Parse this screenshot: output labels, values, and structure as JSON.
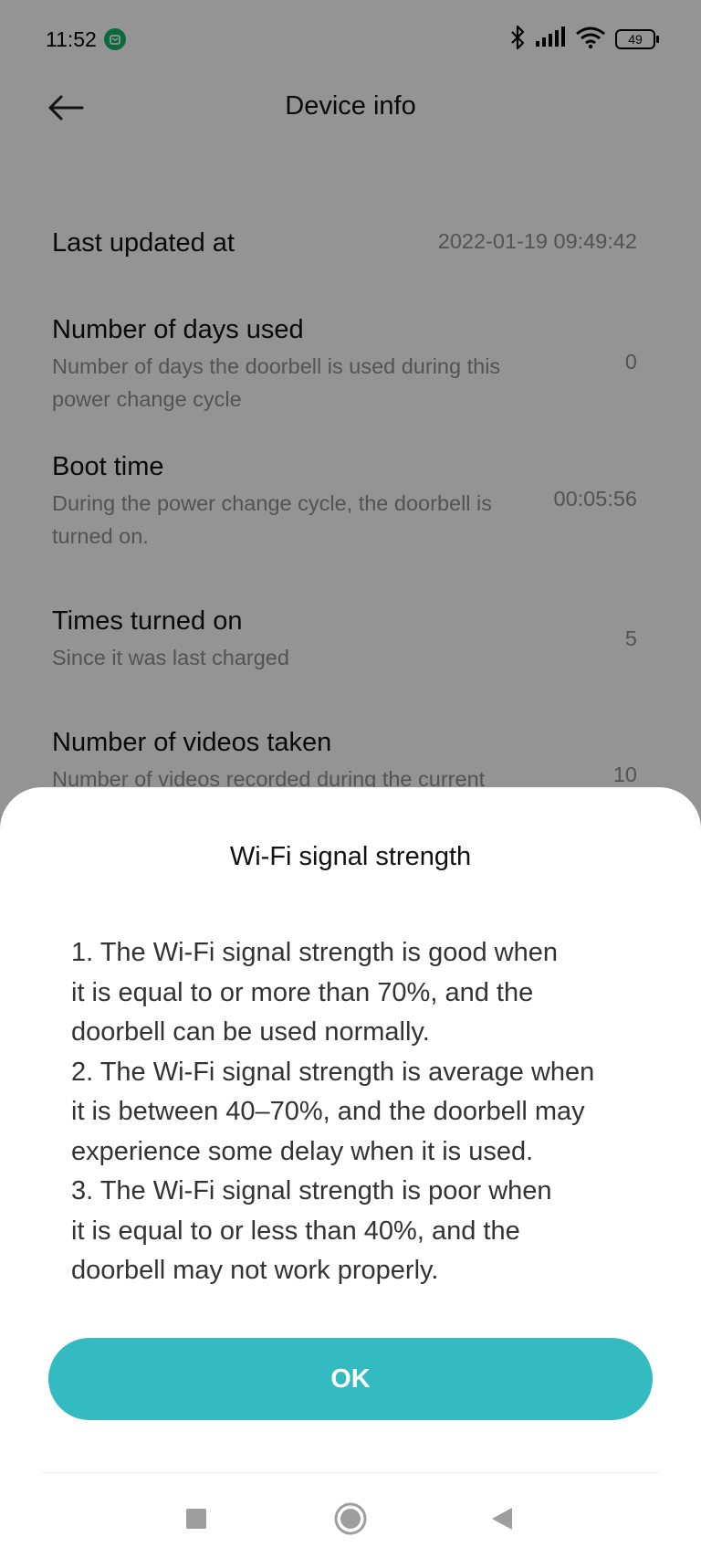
{
  "status_bar": {
    "time": "11:52",
    "battery_level": "49",
    "icons": [
      "mi-home-badge-icon",
      "bluetooth-icon",
      "cellular-signal-icon",
      "wifi-icon",
      "battery-icon"
    ]
  },
  "header": {
    "title": "Device info",
    "back_icon": "back-arrow-icon"
  },
  "info_rows": [
    {
      "title": "Last updated at",
      "value": "2022-01-19 09:49:42"
    },
    {
      "title": "Number of days used",
      "desc": [
        "Number of days the doorbell is used during this",
        "power change cycle"
      ],
      "value": "0"
    },
    {
      "title": "Boot time",
      "desc": [
        "During the power change cycle, the doorbell is",
        "turned on."
      ],
      "value": "00:05:56"
    },
    {
      "title": "Times turned on",
      "desc": [
        "Since it was last charged"
      ],
      "value": "5"
    },
    {
      "title": "Number of videos taken",
      "desc": [
        "Number of videos recorded during the current"
      ],
      "value": "10"
    }
  ],
  "dialog": {
    "title": "Wi-Fi signal strength",
    "lines": [
      "1. The Wi-Fi signal strength is good when",
      "it is equal to or more than 70%, and the",
      "doorbell can be used normally.",
      "2. The Wi-Fi signal strength is average when",
      "it is between 40–70%, and the doorbell may",
      "experience some delay when it is used.",
      "3. The Wi-Fi signal strength is poor when",
      "it is equal to or less than 40%, and the",
      "doorbell may not work properly."
    ],
    "ok_label": "OK",
    "accent_color": "#33bbc1"
  },
  "nav_bar": {
    "icons": [
      "recents-icon",
      "home-icon",
      "back-icon"
    ]
  }
}
